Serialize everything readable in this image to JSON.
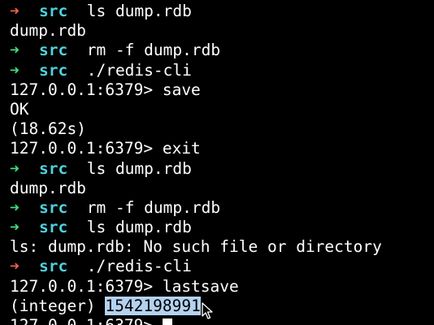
{
  "colors": {
    "background": "#000000",
    "text": "#ffffff",
    "prompt_ok": "#3ee07a",
    "prompt_err": "#f0614c",
    "cwd": "#4fd1dd",
    "selection": "#b4d2f0"
  },
  "lines": [
    {
      "type": "prompt",
      "status": "error",
      "cwd": "src",
      "command": "ls dump.rdb"
    },
    {
      "type": "output",
      "text": "dump.rdb"
    },
    {
      "type": "prompt",
      "status": "ok",
      "cwd": "src",
      "command": "rm -f dump.rdb"
    },
    {
      "type": "prompt",
      "status": "ok",
      "cwd": "src",
      "command": "./redis-cli"
    },
    {
      "type": "output",
      "text": "127.0.0.1:6379> save"
    },
    {
      "type": "output",
      "text": "OK"
    },
    {
      "type": "output",
      "text": "(18.62s)"
    },
    {
      "type": "output",
      "text": "127.0.0.1:6379> exit"
    },
    {
      "type": "prompt",
      "status": "ok",
      "cwd": "src",
      "command": "ls dump.rdb"
    },
    {
      "type": "output",
      "text": "dump.rdb"
    },
    {
      "type": "prompt",
      "status": "ok",
      "cwd": "src",
      "command": "rm -f dump.rdb"
    },
    {
      "type": "prompt",
      "status": "ok",
      "cwd": "src",
      "command": "ls dump.rdb"
    },
    {
      "type": "output",
      "text": "ls: dump.rdb: No such file or directory"
    },
    {
      "type": "prompt",
      "status": "error",
      "cwd": "src",
      "command": "./redis-cli"
    },
    {
      "type": "output",
      "text": "127.0.0.1:6379> lastsave"
    },
    {
      "type": "result",
      "prefix": "(integer) ",
      "selected": "1542198991"
    },
    {
      "type": "input",
      "text": "127.0.0.1:6379> "
    }
  ],
  "icons": {
    "prompt_arrow": "arrow-right-icon",
    "mouse": "mouse-pointer-icon"
  }
}
